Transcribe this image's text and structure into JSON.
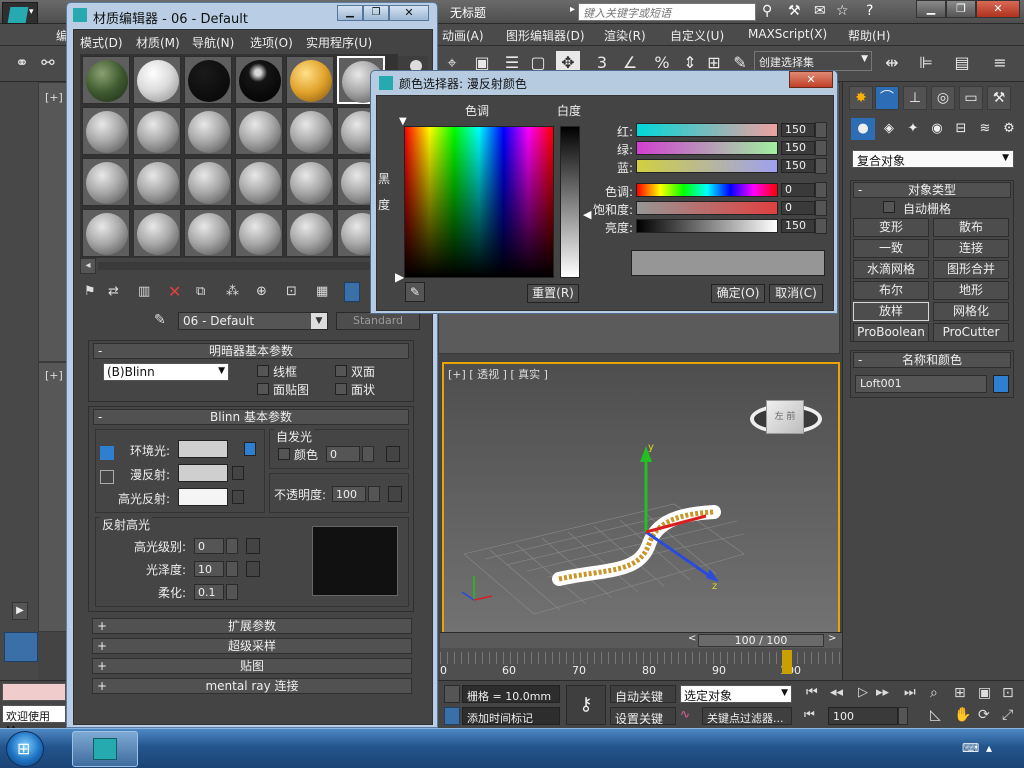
{
  "app": {
    "title": "无标题",
    "search_placeholder": "键入关键字或短语",
    "menu": [
      "动画(A)",
      "图形编辑器(D)",
      "渲染(R)",
      "自定义(U)",
      "MAXScript(X)",
      "帮助(H)"
    ],
    "left_menu_stub": "编",
    "selection_set": "创建选择集",
    "toolbar_number": "3",
    "toolbar_percent": "%"
  },
  "viewports": {
    "top_left_label": "[+]",
    "mid_left_label": "[+]",
    "persp_label": "[+] [ 透视 ] [ 真实 ]",
    "cube_label": "左 前"
  },
  "command_panel": {
    "dropdown": "复合对象",
    "object_type_header": "对象类型",
    "auto_grid": "自动栅格",
    "buttons": [
      "变形",
      "散布",
      "一致",
      "连接",
      "水滴网格",
      "图形合并",
      "布尔",
      "地形",
      "放样",
      "网格化",
      "ProBoolean",
      "ProCutter"
    ],
    "name_color_header": "名称和颜色",
    "object_name": "Loft001",
    "object_color": "#2f7fd0"
  },
  "timeline": {
    "position": "100 / 100",
    "ticks": [
      "0",
      "60",
      "70",
      "80",
      "90",
      "100"
    ]
  },
  "status": {
    "welcome": "欢迎使用 M",
    "grid": "栅格 = 10.0mm",
    "auto_key": "自动关键点",
    "set_key": "设置关键点",
    "selection_mode": "选定对象",
    "add_time_tag": "添加时间标记",
    "key_filters": "关键点过滤器...",
    "frame": "100"
  },
  "material_editor": {
    "title": "材质编辑器 - 06 - Default",
    "menu": [
      "模式(D)",
      "材质(M)",
      "导航(N)",
      "选项(O)",
      "实用程序(U)"
    ],
    "material_name": "06 - Default",
    "material_type": "Standard",
    "shader_rollout": "明暗器基本参数",
    "shader_type": "(B)Blinn",
    "wire": "线框",
    "two_sided": "双面",
    "face_map": "面贴图",
    "faceted": "面状",
    "blinn_rollout": "Blinn 基本参数",
    "self_illum_group": "自发光",
    "color_label": "颜色",
    "self_illum_value": "0",
    "ambient": "环境光:",
    "diffuse": "漫反射:",
    "specular": "高光反射:",
    "opacity_label": "不透明度:",
    "opacity_value": "100",
    "specular_group": "反射高光",
    "spec_level": "高光级别:",
    "spec_level_value": "0",
    "glossiness": "光泽度:",
    "glossiness_value": "10",
    "soften": "柔化:",
    "soften_value": "0.1",
    "rollouts": [
      "扩展参数",
      "超级采样",
      "贴图",
      "mental ray 连接"
    ]
  },
  "color_picker": {
    "title": "颜色选择器: 漫反射颜色",
    "hue_header": "色调",
    "whiteness_header": "白度",
    "blackness_label": "黑度",
    "red": "红:",
    "green": "绿:",
    "blue": "蓝:",
    "hue": "色调:",
    "saturation": "饱和度:",
    "value": "亮度:",
    "red_value": "150",
    "green_value": "150",
    "blue_value": "150",
    "hue_value": "0",
    "saturation_value": "0",
    "value_value": "150",
    "reset": "重置(R)",
    "ok": "确定(O)",
    "cancel": "取消(C)",
    "swatch_color": "#969696"
  }
}
